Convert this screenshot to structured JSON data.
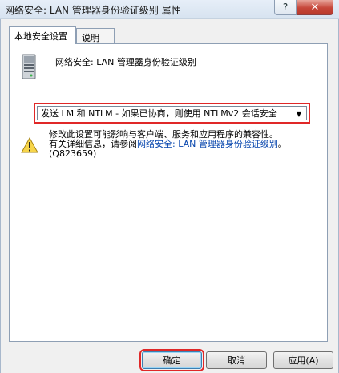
{
  "window": {
    "title": "网络安全: LAN 管理器身份验证级别 属性",
    "help_label": "?",
    "close_label": "✕"
  },
  "tabs": [
    {
      "label": "本地安全设置",
      "active": true
    },
    {
      "label": "说明",
      "active": false
    }
  ],
  "policy": {
    "name": "网络安全: LAN 管理器身份验证级别",
    "icon": "server-icon"
  },
  "dropdown": {
    "selected": "发送 LM 和 NTLM - 如果已协商，则使用 NTLMv2 会话安全"
  },
  "warning": {
    "icon": "warning-icon",
    "line1": "修改此设置可能影响与客户端、服务和应用程序的兼容性。",
    "line2_prefix": "有关详细信息，请参阅",
    "link_text": "网络安全: LAN 管理器身份验证级别",
    "line2_suffix": "。",
    "kb": "(Q823659)"
  },
  "buttons": {
    "ok": "确定",
    "cancel": "取消",
    "apply": "应用(A)"
  },
  "colors": {
    "highlight": "#e02828",
    "link": "#0645ad"
  }
}
